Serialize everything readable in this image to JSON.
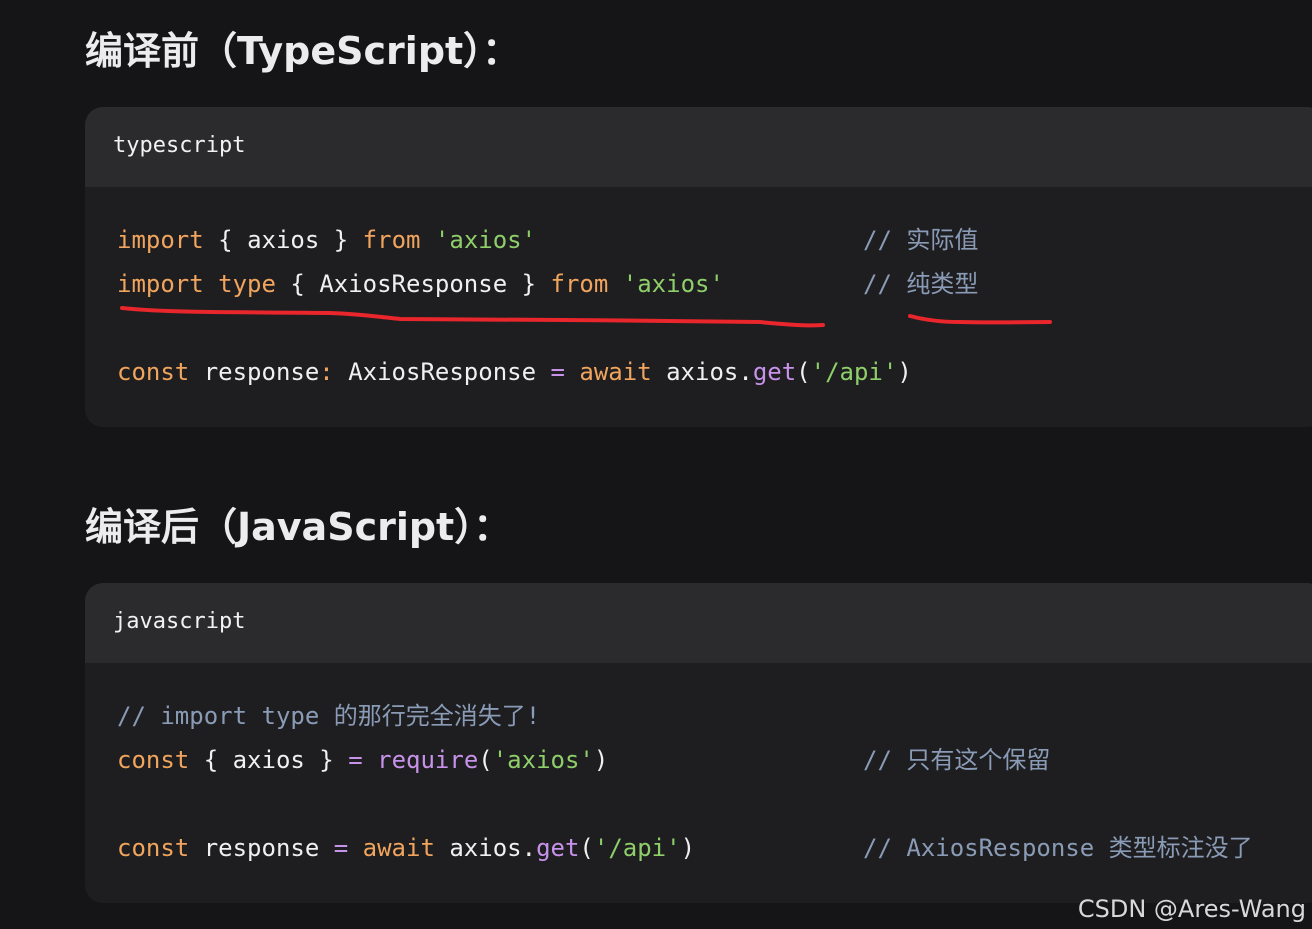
{
  "sections": [
    {
      "heading": "编译前（TypeScript）：",
      "lang": "typescript",
      "lines": [
        {
          "tokens": [
            {
              "t": "import",
              "c": "kw"
            },
            {
              "t": " { ",
              "c": "txt"
            },
            {
              "t": "axios",
              "c": "txt"
            },
            {
              "t": " } ",
              "c": "txt"
            },
            {
              "t": "from",
              "c": "kw"
            },
            {
              "t": " ",
              "c": "txt"
            },
            {
              "t": "'axios'",
              "c": "str"
            }
          ],
          "comment": "// 实际值"
        },
        {
          "tokens": [
            {
              "t": "import",
              "c": "kw"
            },
            {
              "t": " ",
              "c": "txt"
            },
            {
              "t": "type",
              "c": "kw"
            },
            {
              "t": " { ",
              "c": "txt"
            },
            {
              "t": "AxiosResponse",
              "c": "txt"
            },
            {
              "t": " } ",
              "c": "txt"
            },
            {
              "t": "from",
              "c": "kw"
            },
            {
              "t": " ",
              "c": "txt"
            },
            {
              "t": "'axios'",
              "c": "str"
            }
          ],
          "comment": "// 纯类型"
        },
        {
          "tokens": [
            {
              "t": "const",
              "c": "kw"
            },
            {
              "t": " response",
              "c": "txt"
            },
            {
              "t": ":",
              "c": "kw"
            },
            {
              "t": " AxiosResponse ",
              "c": "txt"
            },
            {
              "t": "=",
              "c": "op"
            },
            {
              "t": " ",
              "c": "txt"
            },
            {
              "t": "await",
              "c": "kw"
            },
            {
              "t": " axios.",
              "c": "txt"
            },
            {
              "t": "get",
              "c": "fn"
            },
            {
              "t": "(",
              "c": "txt"
            },
            {
              "t": "'/api'",
              "c": "str"
            },
            {
              "t": ")",
              "c": "txt"
            }
          ],
          "comment": ""
        }
      ]
    },
    {
      "heading": "编译后（JavaScript）：",
      "lang": "javascript",
      "lines": [
        {
          "tokens": [
            {
              "t": "// import type 的那行完全消失了!",
              "c": "cm"
            }
          ],
          "comment": ""
        },
        {
          "tokens": [
            {
              "t": "const",
              "c": "kw"
            },
            {
              "t": " { ",
              "c": "txt"
            },
            {
              "t": "axios",
              "c": "txt"
            },
            {
              "t": " } ",
              "c": "txt"
            },
            {
              "t": "=",
              "c": "op"
            },
            {
              "t": " ",
              "c": "txt"
            },
            {
              "t": "require",
              "c": "fn"
            },
            {
              "t": "(",
              "c": "txt"
            },
            {
              "t": "'axios'",
              "c": "str"
            },
            {
              "t": ")",
              "c": "txt"
            }
          ],
          "comment": "// 只有这个保留"
        },
        {
          "tokens": [
            {
              "t": "const",
              "c": "kw"
            },
            {
              "t": " response ",
              "c": "txt"
            },
            {
              "t": "=",
              "c": "op"
            },
            {
              "t": " ",
              "c": "txt"
            },
            {
              "t": "await",
              "c": "kw"
            },
            {
              "t": " axios.",
              "c": "txt"
            },
            {
              "t": "get",
              "c": "fn"
            },
            {
              "t": "(",
              "c": "txt"
            },
            {
              "t": "'/api'",
              "c": "str"
            },
            {
              "t": ")",
              "c": "txt"
            }
          ],
          "comment": "// AxiosResponse 类型标注没了"
        }
      ]
    }
  ],
  "watermark": "CSDN @Ares-Wang",
  "colors": {
    "background": "#151517",
    "code_background": "#1e1e20",
    "code_header": "#2b2b2e",
    "keyword": "#f0a45d",
    "string": "#8fcf6a",
    "function": "#c792ea",
    "comment": "#8a9bb6",
    "annotation_red": "#e8262b"
  }
}
